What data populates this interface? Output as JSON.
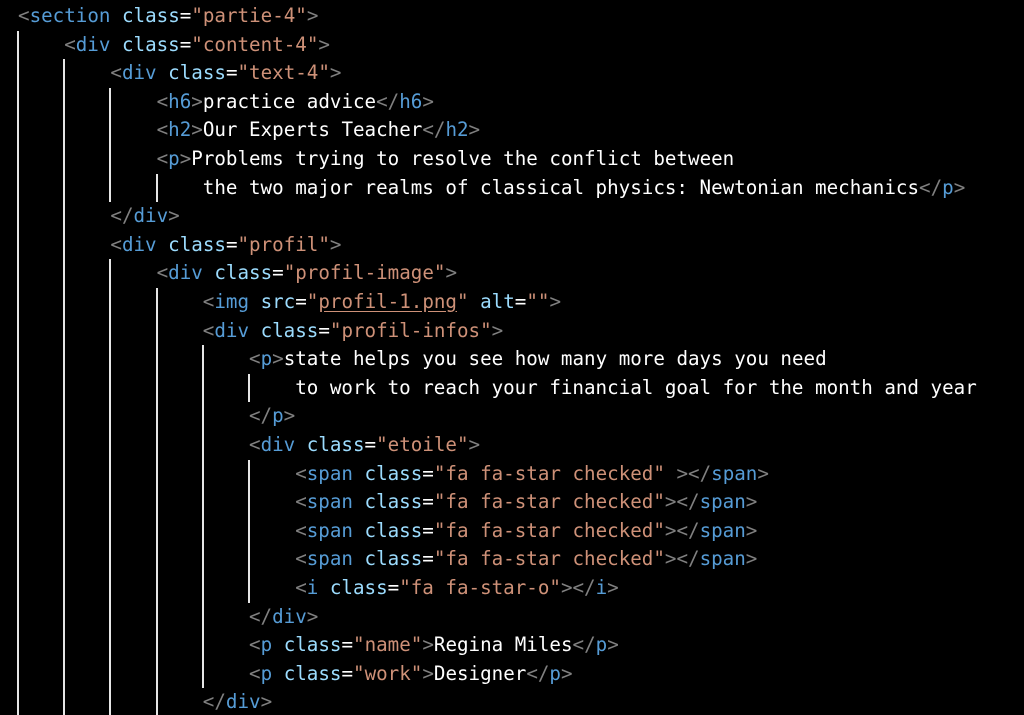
{
  "editor": {
    "colors": {
      "background": "#000000",
      "delimiter": "#808080",
      "tag": "#569cd6",
      "attribute": "#9cdcfe",
      "string": "#ce9178",
      "text": "#ffffff",
      "guide": "#e6e6e6"
    },
    "lines": [
      {
        "indent": 0,
        "tokens": [
          [
            "d",
            "<"
          ],
          [
            "t",
            "section"
          ],
          [
            "p",
            " "
          ],
          [
            "a",
            "class"
          ],
          [
            "p",
            "="
          ],
          [
            "s",
            "\"partie-4\""
          ],
          [
            "d",
            ">"
          ]
        ]
      },
      {
        "indent": 1,
        "tokens": [
          [
            "d",
            "<"
          ],
          [
            "t",
            "div"
          ],
          [
            "p",
            " "
          ],
          [
            "a",
            "class"
          ],
          [
            "p",
            "="
          ],
          [
            "s",
            "\"content-4\""
          ],
          [
            "d",
            ">"
          ]
        ]
      },
      {
        "indent": 2,
        "tokens": [
          [
            "d",
            "<"
          ],
          [
            "t",
            "div"
          ],
          [
            "p",
            " "
          ],
          [
            "a",
            "class"
          ],
          [
            "p",
            "="
          ],
          [
            "s",
            "\"text-4\""
          ],
          [
            "d",
            ">"
          ]
        ]
      },
      {
        "indent": 3,
        "tokens": [
          [
            "d",
            "<"
          ],
          [
            "t",
            "h6"
          ],
          [
            "d",
            ">"
          ],
          [
            "x",
            "practice advice"
          ],
          [
            "d",
            "</"
          ],
          [
            "t",
            "h6"
          ],
          [
            "d",
            ">"
          ]
        ]
      },
      {
        "indent": 3,
        "tokens": [
          [
            "d",
            "<"
          ],
          [
            "t",
            "h2"
          ],
          [
            "d",
            ">"
          ],
          [
            "x",
            "Our Experts Teacher"
          ],
          [
            "d",
            "</"
          ],
          [
            "t",
            "h2"
          ],
          [
            "d",
            ">"
          ]
        ]
      },
      {
        "indent": 3,
        "tokens": [
          [
            "d",
            "<"
          ],
          [
            "t",
            "p"
          ],
          [
            "d",
            ">"
          ],
          [
            "x",
            "Problems trying to resolve the conflict between"
          ]
        ]
      },
      {
        "indent": 3,
        "wrap": true,
        "tokens": [
          [
            "x",
            "the two major realms of classical physics: Newtonian mechanics"
          ],
          [
            "d",
            "</"
          ],
          [
            "t",
            "p"
          ],
          [
            "d",
            ">"
          ]
        ]
      },
      {
        "indent": 2,
        "tokens": [
          [
            "d",
            "</"
          ],
          [
            "t",
            "div"
          ],
          [
            "d",
            ">"
          ]
        ]
      },
      {
        "indent": 2,
        "tokens": [
          [
            "d",
            "<"
          ],
          [
            "t",
            "div"
          ],
          [
            "p",
            " "
          ],
          [
            "a",
            "class"
          ],
          [
            "p",
            "="
          ],
          [
            "s",
            "\"profil\""
          ],
          [
            "d",
            ">"
          ]
        ]
      },
      {
        "indent": 3,
        "tokens": [
          [
            "d",
            "<"
          ],
          [
            "t",
            "div"
          ],
          [
            "p",
            " "
          ],
          [
            "a",
            "class"
          ],
          [
            "p",
            "="
          ],
          [
            "s",
            "\"profil-image\""
          ],
          [
            "d",
            ">"
          ]
        ]
      },
      {
        "indent": 4,
        "tokens": [
          [
            "d",
            "<"
          ],
          [
            "t",
            "img"
          ],
          [
            "p",
            " "
          ],
          [
            "a",
            "src"
          ],
          [
            "p",
            "="
          ],
          [
            "s",
            "\""
          ],
          [
            "l",
            "profil-1.png"
          ],
          [
            "s",
            "\""
          ],
          [
            "p",
            " "
          ],
          [
            "a",
            "alt"
          ],
          [
            "p",
            "="
          ],
          [
            "s",
            "\"\""
          ],
          [
            "d",
            ">"
          ]
        ]
      },
      {
        "indent": 4,
        "tokens": [
          [
            "d",
            "<"
          ],
          [
            "t",
            "div"
          ],
          [
            "p",
            " "
          ],
          [
            "a",
            "class"
          ],
          [
            "p",
            "="
          ],
          [
            "s",
            "\"profil-infos\""
          ],
          [
            "d",
            ">"
          ]
        ]
      },
      {
        "indent": 5,
        "tokens": [
          [
            "d",
            "<"
          ],
          [
            "t",
            "p"
          ],
          [
            "d",
            ">"
          ],
          [
            "x",
            "state helps you see how many more days you need"
          ]
        ]
      },
      {
        "indent": 5,
        "wrap": true,
        "tokens": [
          [
            "x",
            "to work to reach your financial goal for the month and year"
          ]
        ]
      },
      {
        "indent": 5,
        "tokens": [
          [
            "d",
            "</"
          ],
          [
            "t",
            "p"
          ],
          [
            "d",
            ">"
          ]
        ]
      },
      {
        "indent": 5,
        "tokens": [
          [
            "d",
            "<"
          ],
          [
            "t",
            "div"
          ],
          [
            "p",
            " "
          ],
          [
            "a",
            "class"
          ],
          [
            "p",
            "="
          ],
          [
            "s",
            "\"etoile\""
          ],
          [
            "d",
            ">"
          ]
        ]
      },
      {
        "indent": 6,
        "tokens": [
          [
            "d",
            "<"
          ],
          [
            "t",
            "span"
          ],
          [
            "p",
            " "
          ],
          [
            "a",
            "class"
          ],
          [
            "p",
            "="
          ],
          [
            "s",
            "\"fa fa-star checked\""
          ],
          [
            "p",
            " "
          ],
          [
            "d",
            ">"
          ],
          [
            "d",
            "</"
          ],
          [
            "t",
            "span"
          ],
          [
            "d",
            ">"
          ]
        ]
      },
      {
        "indent": 6,
        "tokens": [
          [
            "d",
            "<"
          ],
          [
            "t",
            "span"
          ],
          [
            "p",
            " "
          ],
          [
            "a",
            "class"
          ],
          [
            "p",
            "="
          ],
          [
            "s",
            "\"fa fa-star checked\""
          ],
          [
            "d",
            ">"
          ],
          [
            "d",
            "</"
          ],
          [
            "t",
            "span"
          ],
          [
            "d",
            ">"
          ]
        ]
      },
      {
        "indent": 6,
        "tokens": [
          [
            "d",
            "<"
          ],
          [
            "t",
            "span"
          ],
          [
            "p",
            " "
          ],
          [
            "a",
            "class"
          ],
          [
            "p",
            "="
          ],
          [
            "s",
            "\"fa fa-star checked\""
          ],
          [
            "d",
            ">"
          ],
          [
            "d",
            "</"
          ],
          [
            "t",
            "span"
          ],
          [
            "d",
            ">"
          ]
        ]
      },
      {
        "indent": 6,
        "tokens": [
          [
            "d",
            "<"
          ],
          [
            "t",
            "span"
          ],
          [
            "p",
            " "
          ],
          [
            "a",
            "class"
          ],
          [
            "p",
            "="
          ],
          [
            "s",
            "\"fa fa-star checked\""
          ],
          [
            "d",
            ">"
          ],
          [
            "d",
            "</"
          ],
          [
            "t",
            "span"
          ],
          [
            "d",
            ">"
          ]
        ]
      },
      {
        "indent": 6,
        "tokens": [
          [
            "d",
            "<"
          ],
          [
            "t",
            "i"
          ],
          [
            "p",
            " "
          ],
          [
            "a",
            "class"
          ],
          [
            "p",
            "="
          ],
          [
            "s",
            "\"fa fa-star-o\""
          ],
          [
            "d",
            ">"
          ],
          [
            "d",
            "</"
          ],
          [
            "t",
            "i"
          ],
          [
            "d",
            ">"
          ]
        ]
      },
      {
        "indent": 5,
        "tokens": [
          [
            "d",
            "</"
          ],
          [
            "t",
            "div"
          ],
          [
            "d",
            ">"
          ]
        ]
      },
      {
        "indent": 5,
        "tokens": [
          [
            "d",
            "<"
          ],
          [
            "t",
            "p"
          ],
          [
            "p",
            " "
          ],
          [
            "a",
            "class"
          ],
          [
            "p",
            "="
          ],
          [
            "s",
            "\"name\""
          ],
          [
            "d",
            ">"
          ],
          [
            "x",
            "Regina Miles"
          ],
          [
            "d",
            "</"
          ],
          [
            "t",
            "p"
          ],
          [
            "d",
            ">"
          ]
        ]
      },
      {
        "indent": 5,
        "tokens": [
          [
            "d",
            "<"
          ],
          [
            "t",
            "p"
          ],
          [
            "p",
            " "
          ],
          [
            "a",
            "class"
          ],
          [
            "p",
            "="
          ],
          [
            "s",
            "\"work\""
          ],
          [
            "d",
            ">"
          ],
          [
            "x",
            "Designer"
          ],
          [
            "d",
            "</"
          ],
          [
            "t",
            "p"
          ],
          [
            "d",
            ">"
          ]
        ]
      },
      {
        "indent": 4,
        "tokens": [
          [
            "d",
            "</"
          ],
          [
            "t",
            "div"
          ],
          [
            "d",
            ">"
          ]
        ]
      }
    ]
  }
}
